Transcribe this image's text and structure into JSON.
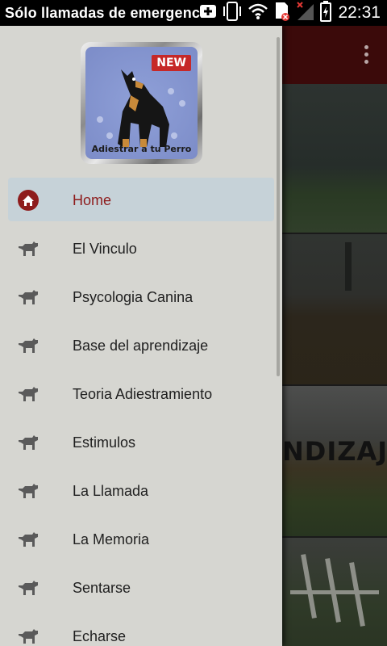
{
  "status_bar": {
    "text": "Sólo llamadas de emergencia",
    "time": "22:31",
    "icons": [
      "usb-icon",
      "phone-vibrate-icon",
      "wifi-icon",
      "sim-error-icon",
      "no-signal-icon",
      "battery-charging-icon"
    ]
  },
  "logo": {
    "badge": "NEW",
    "caption": "Adiestrar a tu Perro"
  },
  "nav": {
    "items": [
      {
        "label": "Home",
        "icon": "home-icon",
        "active": true
      },
      {
        "label": "El Vinculo",
        "icon": "dog-icon"
      },
      {
        "label": "Psycologia Canina",
        "icon": "dog-icon"
      },
      {
        "label": "Base del aprendizaje",
        "icon": "dog-icon"
      },
      {
        "label": "Teoria Adiestramiento",
        "icon": "dog-icon"
      },
      {
        "label": "Estimulos",
        "icon": "dog-icon"
      },
      {
        "label": "La Llamada",
        "icon": "dog-icon"
      },
      {
        "label": "La Memoria",
        "icon": "dog-icon"
      },
      {
        "label": "Sentarse",
        "icon": "dog-icon"
      },
      {
        "label": "Echarse",
        "icon": "dog-icon"
      }
    ]
  },
  "background": {
    "card_title": "NDIZAJE"
  },
  "colors": {
    "status_bar": "#000000",
    "drawer": "#d6d6d1",
    "active_item": "#c6d2d8",
    "active_text": "#8e1c1c",
    "toolbar": "#3b0a0a"
  }
}
